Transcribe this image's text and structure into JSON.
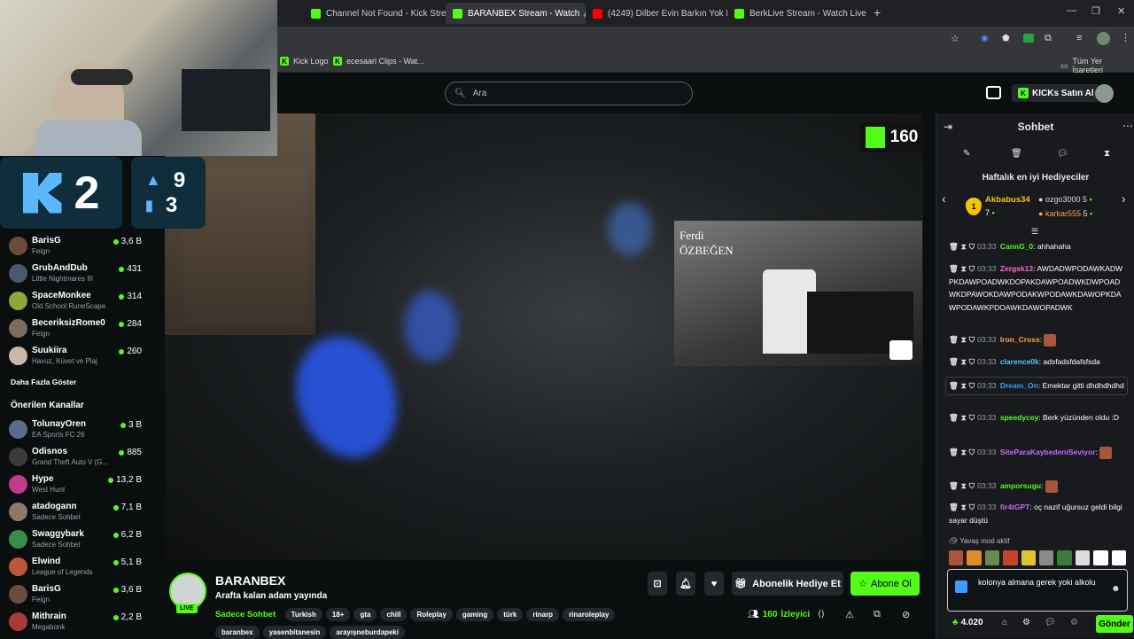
{
  "tabs": [
    {
      "label": "Channel Not Found - Kick Strea",
      "color": "#53fc18"
    },
    {
      "label": "BARANBEX Stream - Watch",
      "color": "#53fc18",
      "active": true
    },
    {
      "label": "(4249) Dilber Evin Barkın Yok M",
      "color": "#ff0000"
    },
    {
      "label": "BerkLive Stream - Watch Live o",
      "color": "#53fc18"
    }
  ],
  "bookmarks": [
    "Kick Logo",
    "ecesaari Clips - Wat..."
  ],
  "bookmarks_all": "Tüm Yer İşaretleri",
  "search": {
    "placeholder": "Ara"
  },
  "header": {
    "buy_ai": "KICKs Satın Al"
  },
  "overlay": {
    "score_k": "2",
    "stat_top": "9",
    "stat_bottom": "3",
    "viewer_badge": "160",
    "clip_name_1": "Ferdi",
    "clip_name_2": "ÖZBEĞEN"
  },
  "sidebar": {
    "followed": [
      {
        "name": "BarisG",
        "category": "Feign",
        "viewers": "3,6 B",
        "color": "#6b4b3a"
      },
      {
        "name": "GrubAndDub",
        "category": "Little Nightmares III",
        "viewers": "431",
        "color": "#4a5a6a"
      },
      {
        "name": "SpaceMonkee",
        "category": "Old School RuneScape",
        "viewers": "314",
        "color": "#8aa83a"
      },
      {
        "name": "BeceriksizRome0",
        "category": "Feign",
        "viewers": "284",
        "color": "#7a6b5a"
      },
      {
        "name": "Suukiira",
        "category": "Havuz, Küvet ve Plaj",
        "viewers": "260",
        "color": "#c9b8a8"
      }
    ],
    "show_more": "Daha Fazla Göster",
    "recommended_title": "Önerilen Kanallar",
    "recommended": [
      {
        "name": "TolunayOren",
        "category": "EA Sports FC 26",
        "viewers": "3 B",
        "color": "#5a6b8a"
      },
      {
        "name": "Odisnos",
        "category": "Grand Theft Auto V (G...",
        "viewers": "885",
        "color": "#3a3a3a"
      },
      {
        "name": "Hype",
        "category": "West Hunt",
        "viewers": "13,2 B",
        "color": "#c43a8a"
      },
      {
        "name": "atadogann",
        "category": "Sadece Sohbet",
        "viewers": "7,1 B",
        "color": "#8a7a6a"
      },
      {
        "name": "Swaggybark",
        "category": "Sadece Sohbet",
        "viewers": "6,2 B",
        "color": "#3a8a4a"
      },
      {
        "name": "Elwind",
        "category": "League of Legends",
        "viewers": "5,1 B",
        "color": "#b85a3a"
      },
      {
        "name": "BarisG",
        "category": "Feign",
        "viewers": "3,6 B",
        "color": "#6b4b3a"
      },
      {
        "name": "Mithrain",
        "category": "Megabonk",
        "viewers": "2,2 B",
        "color": "#a83a3a"
      }
    ]
  },
  "stream": {
    "channel": "BARANBEX",
    "title": "Arafta kalan adam yayında",
    "live_label": "LIVE",
    "category": "Sadece Sohbet",
    "tags": [
      "Turkish",
      "18+",
      "gta",
      "chill",
      "Roleplay",
      "gaming",
      "türk",
      "rinarp",
      "rinaroleplay"
    ],
    "tags2": [
      "baranbex",
      "yasenbitanesin",
      "arayışneburdapeki"
    ],
    "gift_sub": "Abonelik Hediye Et",
    "subscribe": "Abone Ol",
    "viewers": "160",
    "viewers_label": "İzleyici"
  },
  "chat": {
    "title": "Sohbet",
    "top_gifters_title": "Haftalık en iyi Hediyeciler",
    "gifters": [
      {
        "rank": "1",
        "name": "Akbabus34",
        "count": "7"
      },
      {
        "name": "ozgo3000",
        "count": "5"
      },
      {
        "name": "karkar555",
        "count": "5"
      }
    ],
    "messages": [
      {
        "time": "03:33",
        "user": "CannG_0",
        "text": "ahhahaha",
        "color": "#53fc18"
      },
      {
        "time": "03:33",
        "user": "Zergsk13",
        "text": "AWDADWPODAWKADWPKDAWPOADWKDOPAKDAWPOADWKDWPOADWKDPAWOKDAWPODAKWPODAWKDAWOPKDAWPODAWKPDOAWKDAWOPADWK",
        "color": "#ff6ad5"
      },
      {
        "time": "03:33",
        "user": "Iron_Cross",
        "text": "",
        "color": "#ffa44a"
      },
      {
        "time": "03:33",
        "user": "clarence0k",
        "text": "adsfadsfdafsfsda",
        "color": "#53c6fc"
      },
      {
        "time": "03:33",
        "user": "Dream_On",
        "text": "Emektar gitti dhdhdhdhd",
        "color": "#3aa0ff"
      },
      {
        "time": "03:33",
        "user": "speedycey",
        "text": "Berk yüzünden oldu :D",
        "color": "#53fc18"
      },
      {
        "time": "03:33",
        "user": "SiteParaKaybedeniSeviyor",
        "text": "",
        "color": "#c46aff"
      },
      {
        "time": "03:33",
        "user": "amporsugu",
        "text": "",
        "color": "#53fc18"
      },
      {
        "time": "03:33",
        "user": "fir4tGPT",
        "text": "oç nazif uğursuz geldi bilgisayar düştü",
        "color": "#c46aff"
      }
    ],
    "slow_mode": "Yavaş mod aktif",
    "input_value": "kolonya almana gerek yoki alkolu",
    "balance": "4.020",
    "send": "Gönder"
  }
}
